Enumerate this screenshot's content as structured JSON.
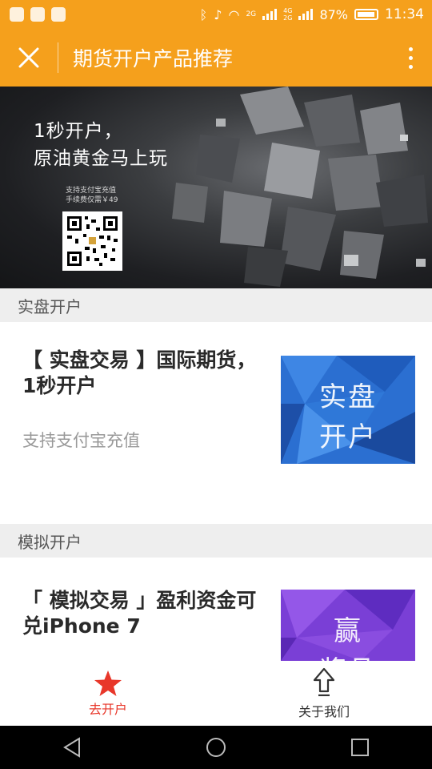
{
  "status_bar": {
    "network_2g": "2G",
    "network_4g": "4G",
    "network_2g_b": "2G",
    "battery_percent": "87%",
    "time": "11:34"
  },
  "app_bar": {
    "title": "期货开户产品推荐"
  },
  "banner": {
    "headline_line1": "1秒开户，",
    "headline_line2": "原油黄金马上玩",
    "note_line1": "支持支付宝充值",
    "note_line2": "手续费仅需￥49"
  },
  "sections": [
    {
      "header": "实盘开户",
      "card": {
        "title": "【 实盘交易 】国际期货，1秒开户",
        "subtitle": "支持支付宝充值",
        "thumb_text_line1": "实盘",
        "thumb_text_line2": "开户"
      }
    },
    {
      "header": "模拟开户",
      "card": {
        "title": "「 模拟交易 」盈利资金可兑iPhone 7",
        "thumb_text_line1": "赢",
        "thumb_text_line2": "奖品"
      }
    }
  ],
  "tab_bar": {
    "items": [
      {
        "label": "去开户",
        "icon": "star-icon",
        "active": true
      },
      {
        "label": "关于我们",
        "icon": "upload-arrow-icon",
        "active": false
      }
    ]
  },
  "colors": {
    "brand_orange": "#f5a01c",
    "active_red": "#e8372a",
    "section_bg": "#eeeeee",
    "subtitle_gray": "#999999"
  }
}
